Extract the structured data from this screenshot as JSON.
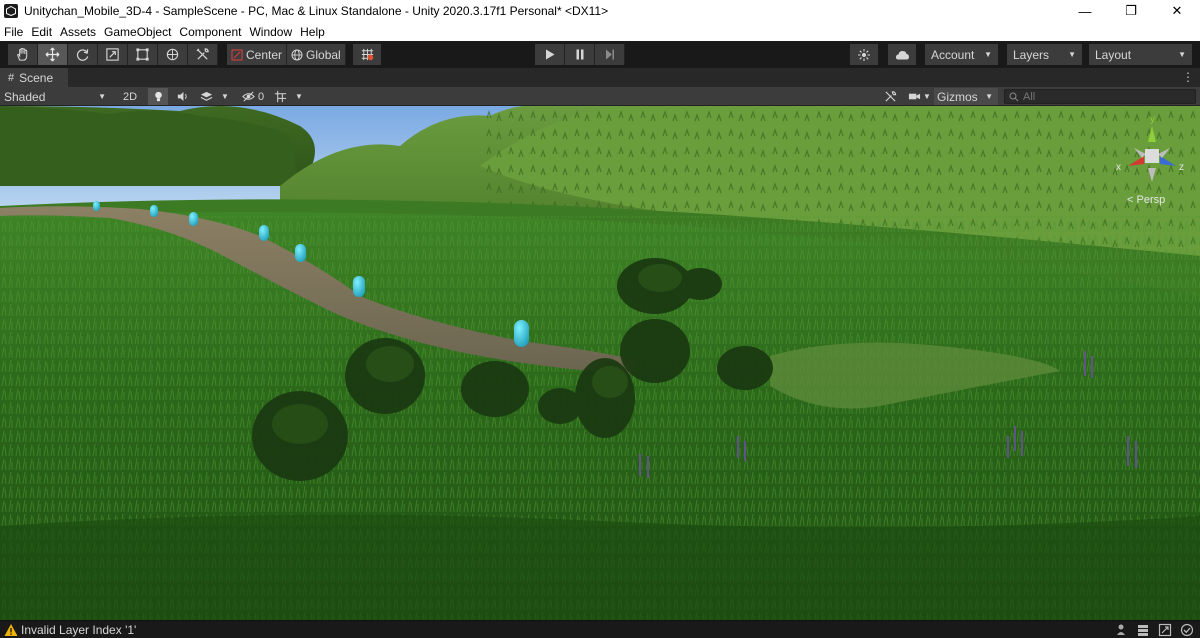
{
  "window": {
    "title": "Unitychan_Mobile_3D-4 - SampleScene - PC, Mac & Linux Standalone - Unity 2020.3.17f1 Personal* <DX11>",
    "controls": [
      "—",
      "❐",
      "✕"
    ]
  },
  "menu": [
    "File",
    "Edit",
    "Assets",
    "GameObject",
    "Component",
    "Window",
    "Help"
  ],
  "toolbar": {
    "tools": [
      "hand-tool",
      "move-tool",
      "rotate-tool",
      "scale-tool",
      "rect-tool",
      "transform-tool",
      "custom-tool"
    ],
    "active_tool": "move-tool",
    "pivot_mode": "Center",
    "pivot_rotation": "Global",
    "account_label": "Account",
    "layers_label": "Layers",
    "layout_label": "Layout"
  },
  "scene_tab": {
    "label": "Scene"
  },
  "scene_toolbar": {
    "draw_mode": "Shaded",
    "two_d_label": "2D",
    "hidden_count": "0",
    "gizmos_label": "Gizmos",
    "search_placeholder": "All"
  },
  "viewport": {
    "projection_label": "Persp",
    "axis_labels": {
      "x": "x",
      "y": "y",
      "z": "z"
    },
    "colors": {
      "sky": "#8fb8e8",
      "hill": "#5f8f3a",
      "grass": "#2f6a1f",
      "path": "#7f7358",
      "capsule": "#36c8e0"
    }
  },
  "status": {
    "message": "Invalid Layer Index '1'"
  }
}
